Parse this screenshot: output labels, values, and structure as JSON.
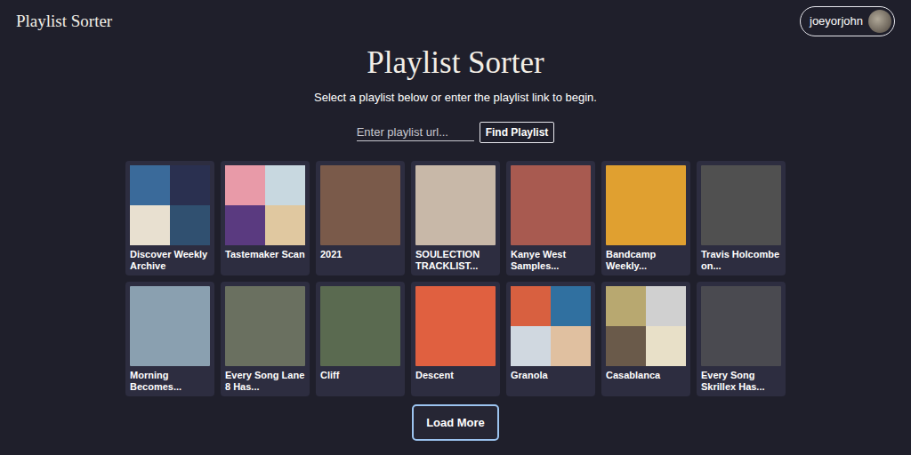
{
  "header": {
    "brand": "Playlist Sorter",
    "user": {
      "name": "joeyorjohn"
    }
  },
  "hero": {
    "title": "Playlist Sorter",
    "subtitle": "Select a playlist below or enter the playlist link to begin.",
    "search": {
      "placeholder": "Enter playlist url...",
      "button": "Find Playlist"
    }
  },
  "playlists": [
    {
      "title": "Discover Weekly Archive",
      "kind": "mosaic",
      "colors": [
        "#3a6a9a",
        "#2a3050",
        "#e8e0d0",
        "#305070"
      ]
    },
    {
      "title": "Tastemaker Scan",
      "kind": "mosaic",
      "colors": [
        "#e89aa8",
        "#c8d8e0",
        "#5a3a80",
        "#e0c8a0"
      ]
    },
    {
      "title": "2021",
      "kind": "photo",
      "colors": [
        "#7a5a4a"
      ]
    },
    {
      "title": "SOULECTION TRACKLIST...",
      "kind": "photo",
      "colors": [
        "#c8b8a8"
      ]
    },
    {
      "title": "Kanye West Samples...",
      "kind": "photo",
      "colors": [
        "#a85a50"
      ]
    },
    {
      "title": "Bandcamp Weekly...",
      "kind": "photo",
      "colors": [
        "#e0a030"
      ]
    },
    {
      "title": "Travis Holcombe on...",
      "kind": "photo",
      "colors": [
        "#505050"
      ]
    },
    {
      "title": "Morning Becomes...",
      "kind": "photo",
      "colors": [
        "#8aa0b0"
      ]
    },
    {
      "title": "Every Song Lane 8 Has...",
      "kind": "photo",
      "colors": [
        "#6a7060"
      ]
    },
    {
      "title": "Cliff",
      "kind": "photo",
      "colors": [
        "#5a6a50"
      ]
    },
    {
      "title": "Descent",
      "kind": "photo",
      "colors": [
        "#e06040"
      ]
    },
    {
      "title": "Granola",
      "kind": "mosaic",
      "colors": [
        "#d86040",
        "#3070a0",
        "#d0d8e0",
        "#e0c0a0"
      ]
    },
    {
      "title": "Casablanca",
      "kind": "mosaic",
      "colors": [
        "#b8a870",
        "#d0d0d0",
        "#6a5a4a",
        "#e8e0c8"
      ]
    },
    {
      "title": "Every Song Skrillex Has...",
      "kind": "photo",
      "colors": [
        "#4a4a50"
      ]
    }
  ],
  "load_more": "Load More"
}
